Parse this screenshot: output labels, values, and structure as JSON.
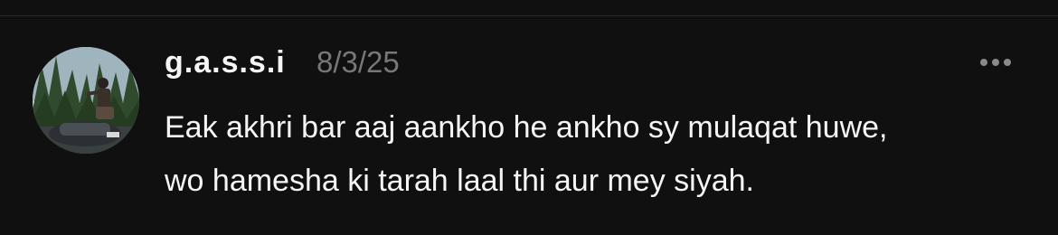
{
  "post": {
    "author": {
      "username": "g.a.s.s.i",
      "avatar_icon": "profile-photo"
    },
    "timestamp": "8/3/25",
    "more_icon": "ellipsis-icon",
    "text_lines": [
      "Eak akhri bar aaj aankho he ankho sy mulaqat huwe,",
      "wo hamesha ki tarah laal thi aur mey siyah."
    ]
  },
  "colors": {
    "background": "#101010",
    "primary_text": "#f3f5f7",
    "secondary_text": "#777777",
    "divider": "#2a2a2a"
  }
}
